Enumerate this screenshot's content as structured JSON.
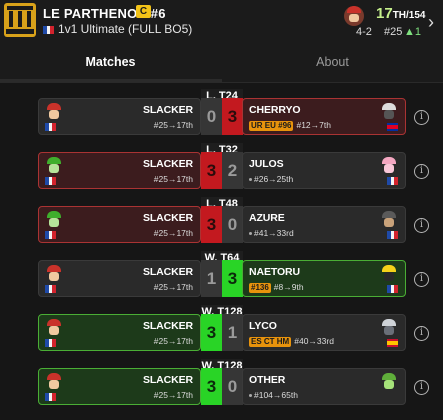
{
  "header": {
    "tournament_name": "LE PARTHENON #6",
    "tier_badge": "C",
    "event_name": "1v1 Ultimate (FULL BO5)",
    "placement": "17",
    "placement_suffix": "TH/154",
    "record": "4-2",
    "seed": "#25",
    "seed_change": "▲1",
    "colors": {
      "placement": "#c6f08c",
      "tier_badge": "#f2c318"
    }
  },
  "tabs": [
    {
      "label": "Matches",
      "active": true
    },
    {
      "label": "About",
      "active": false
    }
  ],
  "matches": [
    {
      "round": "L. T24",
      "result": "loss",
      "player": {
        "name": "SLACKER",
        "seed_line": "#25→17th"
      },
      "opponent": {
        "name": "CHERRYO",
        "tag": "UR EU #96",
        "seed_line": "#12→7th"
      },
      "score": [
        "0",
        "3"
      ]
    },
    {
      "round": "L. T32",
      "result": "loss",
      "player": {
        "name": "SLACKER",
        "seed_line": "#25→17th"
      },
      "opponent": {
        "name": "JULOS",
        "tag": "",
        "seed_line": "#26→25th"
      },
      "score": [
        "3",
        "2"
      ]
    },
    {
      "round": "L. T48",
      "result": "loss",
      "player": {
        "name": "SLACKER",
        "seed_line": "#25→17th"
      },
      "opponent": {
        "name": "AZURE",
        "tag": "",
        "seed_line": "#41→33rd"
      },
      "score": [
        "3",
        "0"
      ]
    },
    {
      "round": "W. T64",
      "result": "win",
      "player": {
        "name": "SLACKER",
        "seed_line": "#25→17th"
      },
      "opponent": {
        "name": "NAETORU",
        "tag": "#136",
        "seed_line": "#8→9th"
      },
      "score": [
        "1",
        "3"
      ]
    },
    {
      "round": "W. T128",
      "result": "win",
      "player": {
        "name": "SLACKER",
        "seed_line": "#25→17th"
      },
      "opponent": {
        "name": "LYCO",
        "tag": "ES CT HM",
        "seed_line": "#40→33rd"
      },
      "score": [
        "3",
        "1"
      ]
    },
    {
      "round": "W. T128",
      "result": "win",
      "player": {
        "name": "SLACKER",
        "seed_line": "#25→17th"
      },
      "opponent": {
        "name": "OTHER",
        "tag": "",
        "seed_line": "#104→65th"
      },
      "score": [
        "3",
        "0"
      ]
    }
  ],
  "icons": {
    "info": "info-circle-icon",
    "chevron": "chevron-right-icon"
  }
}
